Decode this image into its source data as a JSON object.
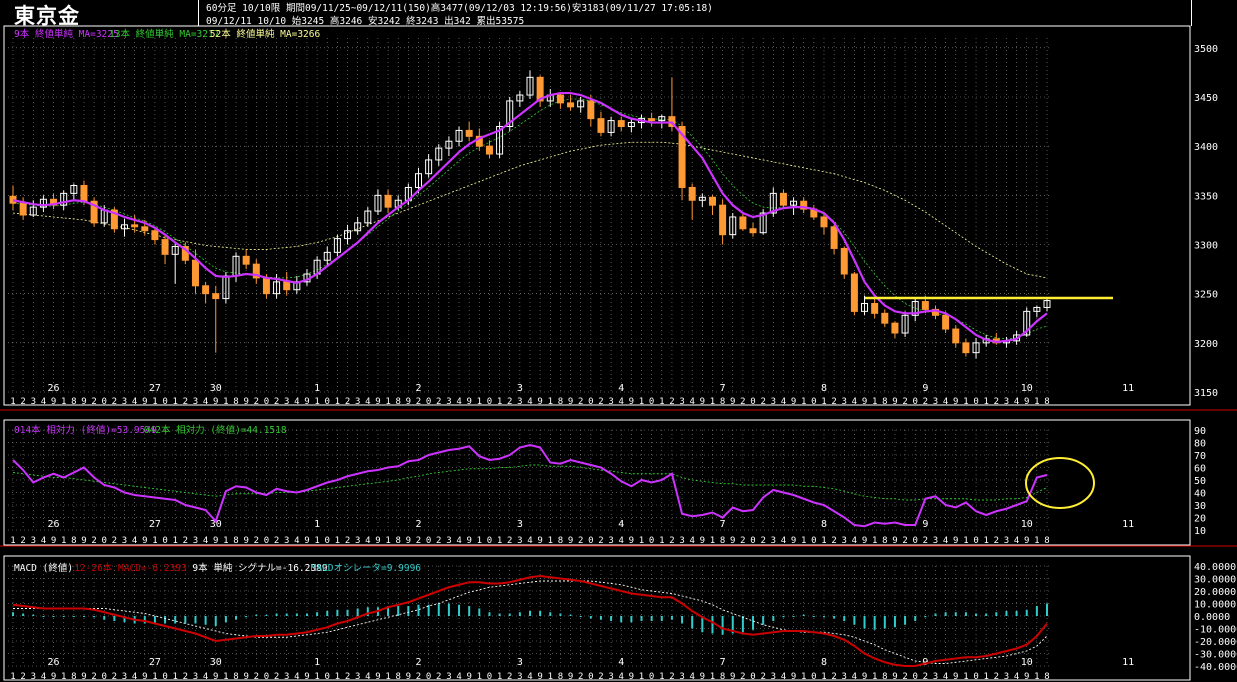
{
  "header": {
    "title": "東京金",
    "line1": "60分足 10/10限 期間09/11/25~09/12/11(150)高3477(09/12/03 12:19:56)安3183(09/11/27 17:05:18)",
    "line2": "09/12/11 10/10 始3245 高3246 安3242 終3243 出342 累出53575"
  },
  "colors": {
    "background": "#000000",
    "up_candle": "#ffffff",
    "down_candle": "#ff9933",
    "ma9": "#cc33ff",
    "ma13": "#33cc33",
    "ma52": "#ffff99",
    "rsi14": "#cc33ff",
    "rsi42": "#33cc33",
    "macd": "#cc0000",
    "signal": "#ffffff",
    "oscillator": "#33cccc",
    "annotation": "#ffee33"
  },
  "panels": {
    "price": {
      "legend": [
        {
          "text": "9本 終値単純 MA=3225",
          "color": "#cc33ff"
        },
        {
          "text": "13本 終値単純 MA=3217",
          "color": "#33cc33"
        },
        {
          "text": "52本 終値単純 MA=3266",
          "color": "#ffff99"
        }
      ],
      "y_ticks": [
        "3500",
        "3450",
        "3400",
        "3350",
        "3300",
        "3250",
        "3200",
        "3150"
      ]
    },
    "rsi": {
      "legend": [
        {
          "text": "014本 相対力 (終値)=53.9549",
          "color": "#cc33ff"
        },
        {
          "text": "042本 相対力 (終値)=44.1518",
          "color": "#33cc33"
        }
      ],
      "y_ticks": [
        "90",
        "80",
        "70",
        "60",
        "50",
        "40",
        "30",
        "20",
        "10"
      ]
    },
    "macd": {
      "legend": [
        {
          "text": "MACD (終値)",
          "color": "#ffffff"
        },
        {
          "text": "12-26本 MACD=-6.2393",
          "color": "#cc0000"
        },
        {
          "text": "9本 単純 シグナル=-16.2389",
          "color": "#ffffff"
        },
        {
          "text": "MACDオシレータ=9.9996",
          "color": "#33cccc"
        }
      ],
      "y_ticks": [
        "40.0000",
        "30.0000",
        "20.0000",
        "10.0000",
        "0.0000",
        "-10.0000",
        "-20.0000",
        "-30.0000",
        "-40.0000"
      ]
    }
  },
  "x_axis": {
    "day_labels": [
      {
        "label": "26",
        "bar": 4
      },
      {
        "label": "27",
        "bar": 14
      },
      {
        "label": "30",
        "bar": 20
      },
      {
        "label": "1",
        "bar": 30
      },
      {
        "label": "2",
        "bar": 40
      },
      {
        "label": "3",
        "bar": 50
      },
      {
        "label": "4",
        "bar": 60
      },
      {
        "label": "7",
        "bar": 70
      },
      {
        "label": "8",
        "bar": 80
      },
      {
        "label": "9",
        "bar": 90
      },
      {
        "label": "10",
        "bar": 100
      },
      {
        "label": "11",
        "bar": 110
      }
    ],
    "hour_labels_row": "1234918920234910"
  },
  "chart_data": {
    "type": "line",
    "ylim": [
      3150,
      3510
    ],
    "bars": [
      [
        3349,
        3360,
        3335,
        3342
      ],
      [
        3342,
        3348,
        3325,
        3330
      ],
      [
        3330,
        3345,
        3328,
        3338
      ],
      [
        3338,
        3350,
        3333,
        3346
      ],
      [
        3346,
        3352,
        3336,
        3340
      ],
      [
        3340,
        3355,
        3335,
        3352
      ],
      [
        3352,
        3362,
        3345,
        3360
      ],
      [
        3360,
        3365,
        3340,
        3344
      ],
      [
        3344,
        3348,
        3318,
        3322
      ],
      [
        3322,
        3340,
        3318,
        3335
      ],
      [
        3335,
        3338,
        3312,
        3316
      ],
      [
        3316,
        3326,
        3308,
        3320
      ],
      [
        3320,
        3330,
        3312,
        3318
      ],
      [
        3318,
        3325,
        3309,
        3314
      ],
      [
        3314,
        3318,
        3300,
        3305
      ],
      [
        3305,
        3310,
        3280,
        3290
      ],
      [
        3290,
        3302,
        3260,
        3298
      ],
      [
        3298,
        3302,
        3280,
        3284
      ],
      [
        3284,
        3295,
        3250,
        3258
      ],
      [
        3258,
        3262,
        3240,
        3250
      ],
      [
        3250,
        3258,
        3190,
        3245
      ],
      [
        3245,
        3272,
        3240,
        3268
      ],
      [
        3268,
        3292,
        3262,
        3288
      ],
      [
        3288,
        3295,
        3275,
        3280
      ],
      [
        3280,
        3285,
        3260,
        3266
      ],
      [
        3266,
        3270,
        3245,
        3250
      ],
      [
        3250,
        3270,
        3245,
        3262
      ],
      [
        3262,
        3272,
        3248,
        3254
      ],
      [
        3254,
        3268,
        3250,
        3262
      ],
      [
        3262,
        3275,
        3258,
        3270
      ],
      [
        3270,
        3288,
        3265,
        3284
      ],
      [
        3284,
        3298,
        3278,
        3292
      ],
      [
        3292,
        3310,
        3288,
        3306
      ],
      [
        3306,
        3320,
        3300,
        3314
      ],
      [
        3314,
        3328,
        3310,
        3322
      ],
      [
        3322,
        3338,
        3318,
        3334
      ],
      [
        3334,
        3356,
        3330,
        3350
      ],
      [
        3350,
        3356,
        3332,
        3338
      ],
      [
        3338,
        3350,
        3335,
        3345
      ],
      [
        3345,
        3362,
        3340,
        3358
      ],
      [
        3358,
        3378,
        3352,
        3372
      ],
      [
        3372,
        3392,
        3368,
        3386
      ],
      [
        3386,
        3402,
        3380,
        3398
      ],
      [
        3398,
        3410,
        3390,
        3405
      ],
      [
        3405,
        3420,
        3400,
        3416
      ],
      [
        3416,
        3425,
        3405,
        3410
      ],
      [
        3410,
        3418,
        3395,
        3400
      ],
      [
        3400,
        3406,
        3388,
        3392
      ],
      [
        3392,
        3425,
        3388,
        3420
      ],
      [
        3420,
        3450,
        3415,
        3446
      ],
      [
        3446,
        3456,
        3440,
        3452
      ],
      [
        3452,
        3477,
        3448,
        3470
      ],
      [
        3470,
        3472,
        3440,
        3446
      ],
      [
        3446,
        3458,
        3440,
        3452
      ],
      [
        3452,
        3455,
        3438,
        3444
      ],
      [
        3444,
        3452,
        3436,
        3440
      ],
      [
        3440,
        3450,
        3434,
        3446
      ],
      [
        3446,
        3452,
        3420,
        3428
      ],
      [
        3428,
        3435,
        3410,
        3414
      ],
      [
        3414,
        3430,
        3410,
        3426
      ],
      [
        3426,
        3430,
        3415,
        3420
      ],
      [
        3420,
        3428,
        3414,
        3424
      ],
      [
        3424,
        3432,
        3418,
        3428
      ],
      [
        3428,
        3434,
        3420,
        3426
      ],
      [
        3426,
        3432,
        3418,
        3430
      ],
      [
        3430,
        3470,
        3415,
        3420
      ],
      [
        3420,
        3425,
        3345,
        3358
      ],
      [
        3358,
        3362,
        3325,
        3345
      ],
      [
        3345,
        3352,
        3338,
        3348
      ],
      [
        3348,
        3350,
        3330,
        3340
      ],
      [
        3340,
        3346,
        3300,
        3310
      ],
      [
        3310,
        3332,
        3306,
        3328
      ],
      [
        3328,
        3332,
        3314,
        3316
      ],
      [
        3316,
        3322,
        3308,
        3312
      ],
      [
        3312,
        3336,
        3310,
        3332
      ],
      [
        3332,
        3358,
        3328,
        3352
      ],
      [
        3352,
        3356,
        3336,
        3340
      ],
      [
        3340,
        3348,
        3330,
        3344
      ],
      [
        3344,
        3348,
        3332,
        3336
      ],
      [
        3336,
        3340,
        3325,
        3328
      ],
      [
        3328,
        3332,
        3310,
        3318
      ],
      [
        3318,
        3320,
        3290,
        3296
      ],
      [
        3296,
        3298,
        3265,
        3270
      ],
      [
        3270,
        3272,
        3228,
        3232
      ],
      [
        3232,
        3248,
        3228,
        3240
      ],
      [
        3240,
        3246,
        3225,
        3230
      ],
      [
        3230,
        3234,
        3216,
        3220
      ],
      [
        3220,
        3222,
        3205,
        3210
      ],
      [
        3210,
        3232,
        3206,
        3228
      ],
      [
        3228,
        3246,
        3222,
        3242
      ],
      [
        3242,
        3248,
        3230,
        3234
      ],
      [
        3234,
        3238,
        3224,
        3228
      ],
      [
        3228,
        3232,
        3210,
        3214
      ],
      [
        3214,
        3218,
        3195,
        3200
      ],
      [
        3200,
        3204,
        3186,
        3190
      ],
      [
        3190,
        3205,
        3184,
        3200
      ],
      [
        3200,
        3208,
        3196,
        3204
      ],
      [
        3204,
        3210,
        3198,
        3200
      ],
      [
        3200,
        3206,
        3195,
        3202
      ],
      [
        3202,
        3212,
        3198,
        3208
      ],
      [
        3208,
        3236,
        3206,
        3232
      ],
      [
        3232,
        3238,
        3226,
        3236
      ],
      [
        3236,
        3246,
        3232,
        3243
      ]
    ],
    "ma9": [
      3345,
      3343,
      3341,
      3340,
      3341,
      3343,
      3345,
      3344,
      3340,
      3335,
      3332,
      3328,
      3325,
      3322,
      3317,
      3310,
      3302,
      3295,
      3286,
      3276,
      3268,
      3267,
      3268,
      3270,
      3269,
      3266,
      3265,
      3263,
      3261,
      3264,
      3270,
      3278,
      3286,
      3294,
      3302,
      3312,
      3322,
      3330,
      3338,
      3345,
      3355,
      3364,
      3374,
      3384,
      3394,
      3402,
      3408,
      3412,
      3416,
      3424,
      3432,
      3440,
      3448,
      3452,
      3454,
      3454,
      3452,
      3448,
      3444,
      3438,
      3432,
      3428,
      3426,
      3424,
      3424,
      3424,
      3412,
      3400,
      3388,
      3370,
      3352,
      3340,
      3332,
      3328,
      3330,
      3334,
      3337,
      3338,
      3338,
      3336,
      3332,
      3322,
      3305,
      3284,
      3262,
      3248,
      3238,
      3232,
      3230,
      3230,
      3232,
      3233,
      3230,
      3224,
      3216,
      3208,
      3203,
      3201,
      3202,
      3204,
      3212,
      3222,
      3230
    ],
    "ma13": [
      3342,
      3341,
      3340,
      3339,
      3339,
      3340,
      3342,
      3343,
      3341,
      3338,
      3335,
      3331,
      3327,
      3324,
      3319,
      3313,
      3306,
      3299,
      3291,
      3283,
      3276,
      3272,
      3271,
      3270,
      3269,
      3267,
      3266,
      3266,
      3267,
      3270,
      3274,
      3280,
      3287,
      3294,
      3302,
      3310,
      3318,
      3326,
      3334,
      3342,
      3350,
      3358,
      3367,
      3376,
      3385,
      3393,
      3399,
      3404,
      3409,
      3415,
      3422,
      3429,
      3436,
      3442,
      3446,
      3448,
      3448,
      3446,
      3442,
      3438,
      3434,
      3431,
      3429,
      3428,
      3427,
      3427,
      3420,
      3410,
      3399,
      3386,
      3372,
      3360,
      3350,
      3342,
      3338,
      3337,
      3338,
      3338,
      3337,
      3335,
      3331,
      3324,
      3312,
      3298,
      3283,
      3270,
      3258,
      3248,
      3240,
      3235,
      3232,
      3230,
      3228,
      3224,
      3219,
      3213,
      3208,
      3205,
      3204,
      3205,
      3209,
      3214,
      3217
    ],
    "ma52": [
      3332,
      3331,
      3330,
      3329,
      3328,
      3327,
      3326,
      3325,
      3323,
      3321,
      3319,
      3317,
      3315,
      3312,
      3310,
      3307,
      3305,
      3303,
      3301,
      3299,
      3298,
      3297,
      3296,
      3295,
      3295,
      3295,
      3296,
      3297,
      3298,
      3300,
      3302,
      3305,
      3308,
      3312,
      3316,
      3320,
      3324,
      3328,
      3332,
      3336,
      3340,
      3344,
      3348,
      3352,
      3356,
      3360,
      3364,
      3368,
      3372,
      3376,
      3380,
      3383,
      3386,
      3389,
      3392,
      3395,
      3397,
      3399,
      3401,
      3402,
      3403,
      3404,
      3404,
      3404,
      3404,
      3403,
      3402,
      3400,
      3398,
      3396,
      3394,
      3392,
      3390,
      3388,
      3386,
      3384,
      3382,
      3380,
      3378,
      3376,
      3374,
      3372,
      3369,
      3366,
      3363,
      3359,
      3355,
      3350,
      3345,
      3339,
      3333,
      3326,
      3319,
      3312,
      3305,
      3298,
      3292,
      3286,
      3280,
      3275,
      3270,
      3268,
      3266
    ],
    "rsi14": [
      66,
      58,
      48,
      52,
      55,
      52,
      56,
      60,
      52,
      46,
      44,
      40,
      38,
      37,
      36,
      35,
      34,
      30,
      28,
      26,
      17,
      41,
      45,
      44,
      40,
      38,
      43,
      41,
      40,
      42,
      45,
      48,
      50,
      53,
      55,
      57,
      58,
      60,
      61,
      65,
      66,
      70,
      72,
      74,
      75,
      77,
      69,
      66,
      67,
      70,
      76,
      78,
      76,
      64,
      63,
      66,
      64,
      62,
      60,
      55,
      49,
      45,
      50,
      48,
      50,
      55,
      23,
      21,
      22,
      24,
      20,
      28,
      25,
      26,
      36,
      42,
      40,
      38,
      35,
      32,
      30,
      25,
      20,
      14,
      13,
      16,
      15,
      16,
      14,
      14,
      35,
      37,
      30,
      28,
      32,
      25,
      22,
      25,
      27,
      30,
      33,
      52,
      54
    ],
    "rsi42": [
      56,
      55,
      54,
      53,
      52,
      52,
      51,
      50,
      49,
      48,
      47,
      46,
      45,
      44,
      43,
      42,
      41,
      40,
      39,
      38,
      37,
      38,
      39,
      39,
      39,
      39,
      40,
      40,
      40,
      41,
      42,
      43,
      44,
      45,
      46,
      47,
      48,
      49,
      50,
      52,
      53,
      55,
      56,
      57,
      58,
      59,
      59,
      59,
      60,
      60,
      61,
      62,
      62,
      61,
      61,
      61,
      60,
      59,
      58,
      57,
      56,
      55,
      55,
      55,
      55,
      55,
      52,
      50,
      49,
      48,
      47,
      47,
      46,
      46,
      46,
      46,
      46,
      46,
      45,
      45,
      44,
      43,
      41,
      39,
      37,
      36,
      35,
      35,
      34,
      34,
      35,
      35,
      35,
      35,
      35,
      34,
      34,
      34,
      35,
      35,
      36,
      40,
      44
    ],
    "macd": [
      9,
      8,
      7,
      6,
      6,
      6,
      6,
      6,
      5,
      3,
      1,
      -1,
      -3,
      -4,
      -6,
      -8,
      -10,
      -12,
      -14,
      -17,
      -20,
      -19,
      -18,
      -17,
      -16,
      -16,
      -15,
      -15,
      -14,
      -13,
      -11,
      -9,
      -6,
      -4,
      -1,
      2,
      4,
      7,
      9,
      11,
      14,
      17,
      20,
      23,
      25,
      27,
      27,
      26,
      26,
      27,
      29,
      31,
      32,
      31,
      30,
      29,
      28,
      26,
      24,
      22,
      20,
      18,
      17,
      16,
      15,
      15,
      10,
      4,
      -1,
      -5,
      -10,
      -12,
      -14,
      -15,
      -14,
      -13,
      -12,
      -12,
      -12,
      -13,
      -14,
      -16,
      -19,
      -24,
      -30,
      -34,
      -37,
      -39,
      -40,
      -40,
      -38,
      -36,
      -35,
      -34,
      -33,
      -33,
      -32,
      -30,
      -28,
      -26,
      -23,
      -16,
      -6
    ],
    "signal": [
      6,
      6,
      6,
      6,
      6,
      6,
      6,
      6,
      6,
      6,
      5,
      4,
      3,
      2,
      0,
      -2,
      -4,
      -6,
      -8,
      -10,
      -12,
      -14,
      -15,
      -16,
      -17,
      -17,
      -17,
      -17,
      -16,
      -15,
      -14,
      -13,
      -11,
      -9,
      -7,
      -5,
      -3,
      -1,
      1,
      3,
      5,
      8,
      10,
      13,
      16,
      19,
      21,
      23,
      24,
      25,
      26,
      27,
      28,
      28,
      28,
      28,
      28,
      28,
      27,
      26,
      25,
      23,
      21,
      20,
      19,
      18,
      16,
      14,
      12,
      9,
      5,
      2,
      -1,
      -4,
      -7,
      -9,
      -11,
      -12,
      -13,
      -13,
      -13,
      -14,
      -15,
      -17,
      -20,
      -23,
      -27,
      -30,
      -33,
      -36,
      -37,
      -38,
      -38,
      -37,
      -36,
      -35,
      -34,
      -33,
      -32,
      -30,
      -28,
      -24,
      -16
    ]
  }
}
